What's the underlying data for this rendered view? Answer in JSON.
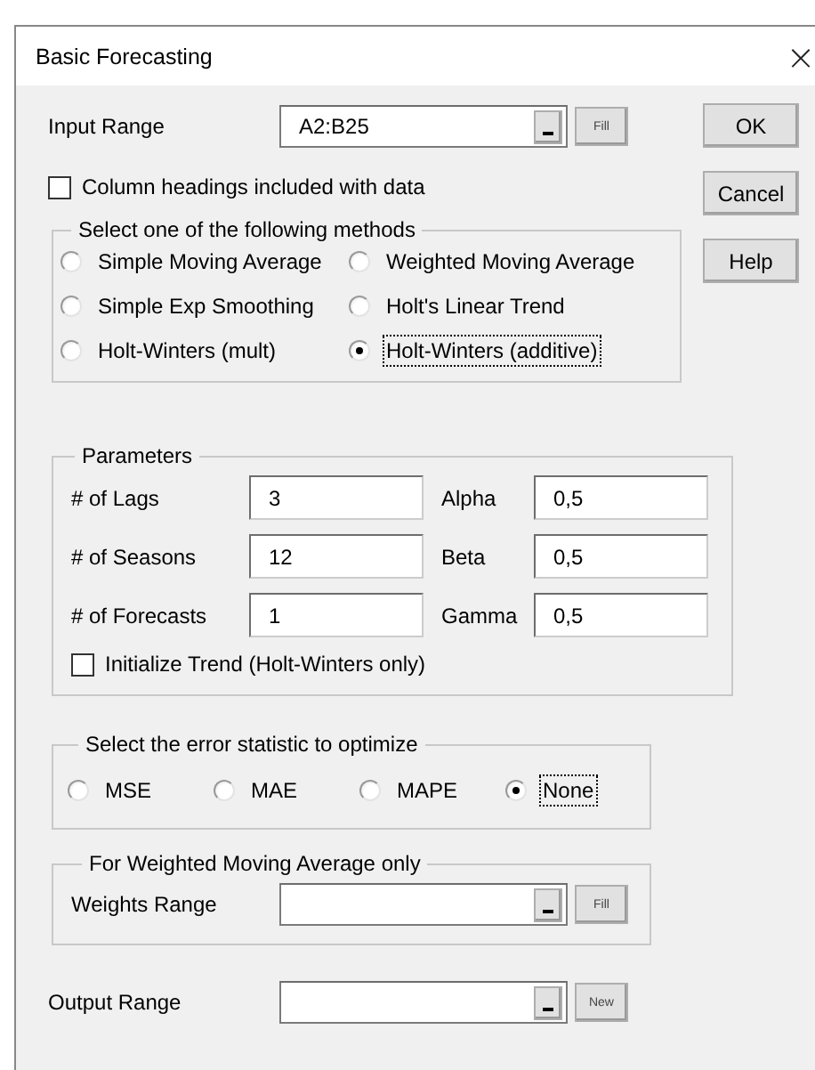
{
  "window": {
    "title": "Basic Forecasting",
    "close": "×"
  },
  "input_range": {
    "label": "Input Range",
    "value": "A2:B25",
    "button": "Fill"
  },
  "buttons": [
    {
      "label": "OK"
    },
    {
      "label": "Cancel"
    },
    {
      "label": "Help"
    }
  ],
  "column_headings": {
    "label": "Column headings included with data",
    "checked": false
  },
  "methods": {
    "title": "Select one of the following methods",
    "options": [
      {
        "label": "Simple Moving Average",
        "selected": false
      },
      {
        "label": "Weighted Moving Average",
        "selected": false
      },
      {
        "label": "Simple Exp Smoothing",
        "selected": false
      },
      {
        "label": "Holt's Linear Trend",
        "selected": false
      },
      {
        "label": "Holt-Winters (mult)",
        "selected": false
      },
      {
        "label": "Holt-Winters (additive)",
        "selected": true
      }
    ]
  },
  "parameters": {
    "title": "Parameters",
    "fields": [
      {
        "label": "# of Lags",
        "value": "3"
      },
      {
        "label": "Alpha",
        "value": "0,5"
      },
      {
        "label": "# of Seasons",
        "value": "12"
      },
      {
        "label": "Beta",
        "value": "0,5"
      },
      {
        "label": "# of Forecasts",
        "value": "1"
      },
      {
        "label": "Gamma",
        "value": "0,5"
      }
    ],
    "initialize_trend": {
      "label": "Initialize Trend (Holt-Winters only)",
      "checked": false
    }
  },
  "error_statistic": {
    "title": "Select the error statistic to optimize",
    "options": [
      {
        "label": "MSE",
        "selected": false
      },
      {
        "label": "MAE",
        "selected": false
      },
      {
        "label": "MAPE",
        "selected": false
      },
      {
        "label": "None",
        "selected": true
      }
    ]
  },
  "weights": {
    "title": "For Weighted Moving Average only",
    "label": "Weights Range",
    "button": "Fill"
  },
  "output_range": {
    "label": "Output Range",
    "button": "New"
  }
}
